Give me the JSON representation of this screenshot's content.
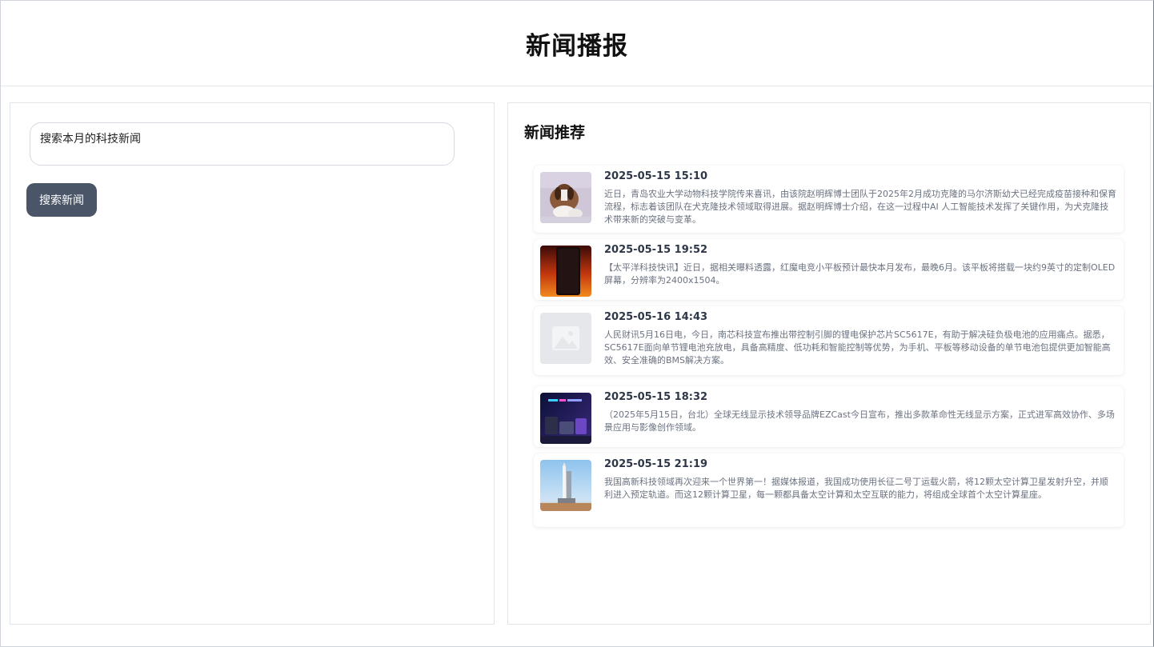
{
  "header": {
    "title": "新闻播报"
  },
  "search": {
    "value": "搜索本月的科技新闻",
    "button_label": "搜索新闻"
  },
  "recommend": {
    "title": "新闻推荐",
    "items": [
      {
        "date": "2025-05-15 15:10",
        "text": "近日，青岛农业大学动物科技学院传来喜讯，由该院赵明辉博士团队于2025年2月成功克隆的马尔济斯幼犬已经完成疫苗接种和保育流程，标志着该团队在犬克隆技术领域取得进展。据赵明辉博士介绍，在这一过程中AI 人工智能技术发挥了关键作用，为犬克隆技术带来新的突破与变革。",
        "image": "beagle-dog-photo"
      },
      {
        "date": "2025-05-15 19:52",
        "text": "【太平洋科技快讯】近日，据相关曝料透露，红魔电竞小平板预计最快本月发布，最晚6月。该平板将搭载一块约9英寸的定制OLED屏幕，分辨率为2400x1504。",
        "image": "red-tablet-photo"
      },
      {
        "date": "2025-05-16 14:43",
        "text": "人民财讯5月16日电，今日，南芯科技宣布推出带控制引脚的锂电保护芯片SC5617E，有助于解决硅负极电池的应用痛点。据悉，SC5617E面向单节锂电池充放电，具备高精度、低功耗和智能控制等优势，为手机、平板等移动设备的单节电池包提供更加智能高效、安全准确的BMS解决方案。",
        "image": "image-placeholder-icon"
      },
      {
        "date": "2025-05-15 18:32",
        "text": "（2025年5月15日，台北）全球无线显示技术领导品牌EZCast今日宣布，推出多款革命性无线显示方案，正式进军高效协作、多场景应用与影像创作领域。",
        "image": "ezcast-devices-photo"
      },
      {
        "date": "2025-05-15 21:19",
        "text": "我国高新科技领域再次迎来一个世界第一！据媒体报道，我国成功使用长征二号丁运载火箭，将12颗太空计算卫星发射升空，并顺利进入预定轨道。而这12颗计算卫星，每一颗都具备太空计算和太空互联的能力，将组成全球首个太空计算星座。",
        "image": "rocket-launch-photo"
      }
    ]
  }
}
